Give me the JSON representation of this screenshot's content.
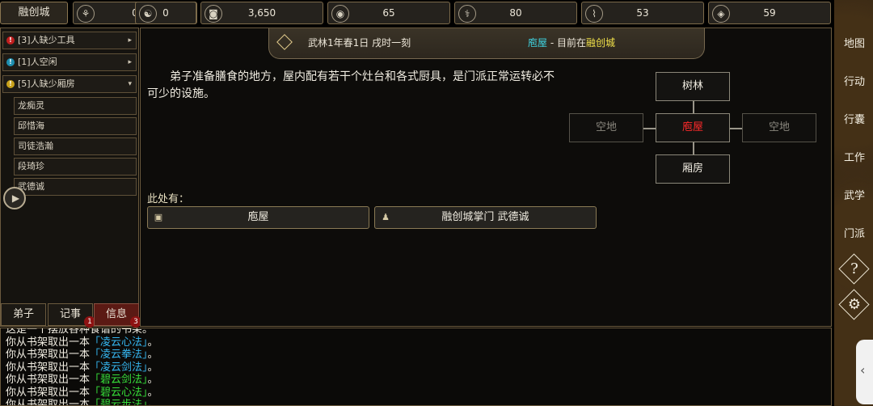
{
  "topbar": {
    "city": "融创城",
    "resources": [
      {
        "icon": "disciples-icon",
        "glyph": "⚘",
        "value": "0"
      },
      {
        "icon": "yin-yang-icon",
        "glyph": "☯",
        "value": "0"
      },
      {
        "icon": "coin-icon",
        "glyph": "◙",
        "value": "3,650"
      },
      {
        "icon": "food-bowl-icon",
        "glyph": "◉",
        "value": "65"
      },
      {
        "icon": "herb-icon",
        "glyph": "⚕",
        "value": "80"
      },
      {
        "icon": "scroll-icon",
        "glyph": "⌇",
        "value": "53"
      },
      {
        "icon": "ore-icon",
        "glyph": "◈",
        "value": "59"
      }
    ]
  },
  "tasks": [
    {
      "label": "[3]人缺少工具",
      "color": "#c21f1f",
      "mark": "!",
      "arrow": "▸"
    },
    {
      "label": "[1]人空闲",
      "color": "#1e8fb0",
      "mark": "!",
      "arrow": "▸"
    },
    {
      "label": "[5]人缺少厢房",
      "color": "#c9a21b",
      "mark": "!",
      "arrow": "▾"
    }
  ],
  "people": [
    "龙痴灵",
    "邱惜海",
    "司徒浩瀚",
    "段琦珍",
    "武德诚"
  ],
  "tabs": [
    {
      "label": "弟子",
      "badge": ""
    },
    {
      "label": "记事",
      "badge": "1"
    },
    {
      "label": "信息",
      "badge": "3"
    }
  ],
  "header": {
    "date": "武林1年春1日 戌时一刻",
    "location": "庖屋",
    "separator": " - 目前在",
    "city": "融创城"
  },
  "description": "弟子准备膳食的地方，屋内配有若干个灶台和各式厨具，是门派正常运转必不可少的设施。",
  "map": {
    "north": "树林",
    "west": "空地",
    "current": "庖屋",
    "east": "空地",
    "south": "厢房"
  },
  "here": {
    "label": "此处有：",
    "items": [
      {
        "label": "庖屋",
        "icon": "box-icon",
        "glyph": "▣"
      },
      {
        "label": "融创城掌门 武德诚",
        "icon": "person-icon",
        "glyph": "♟"
      }
    ]
  },
  "log": {
    "partial_top": "这是一个摆放各种食谱的书架。",
    "prefix": "你从书架取出一本",
    "suffix": "。",
    "lines": [
      {
        "book": "「凌云心法」",
        "color": "blue"
      },
      {
        "book": "「凌云拳法」",
        "color": "blue"
      },
      {
        "book": "「凌云剑法」",
        "color": "blue"
      },
      {
        "book": "「碧云剑法」",
        "color": "green"
      },
      {
        "book": "「碧云心法」",
        "color": "green"
      },
      {
        "book": "「碧云步法」",
        "color": "green"
      }
    ]
  },
  "nav": [
    {
      "name": "map-nav",
      "label": "地图"
    },
    {
      "name": "action-nav",
      "label": "行动"
    },
    {
      "name": "bag-nav",
      "label": "行囊"
    },
    {
      "name": "work-nav",
      "label": "工作"
    },
    {
      "name": "martial-nav",
      "label": "武学"
    },
    {
      "name": "sect-nav",
      "label": "门派"
    },
    {
      "name": "help-nav",
      "label": "?"
    },
    {
      "name": "settings-nav",
      "label": "⚙"
    }
  ],
  "edge_tab": "‹"
}
